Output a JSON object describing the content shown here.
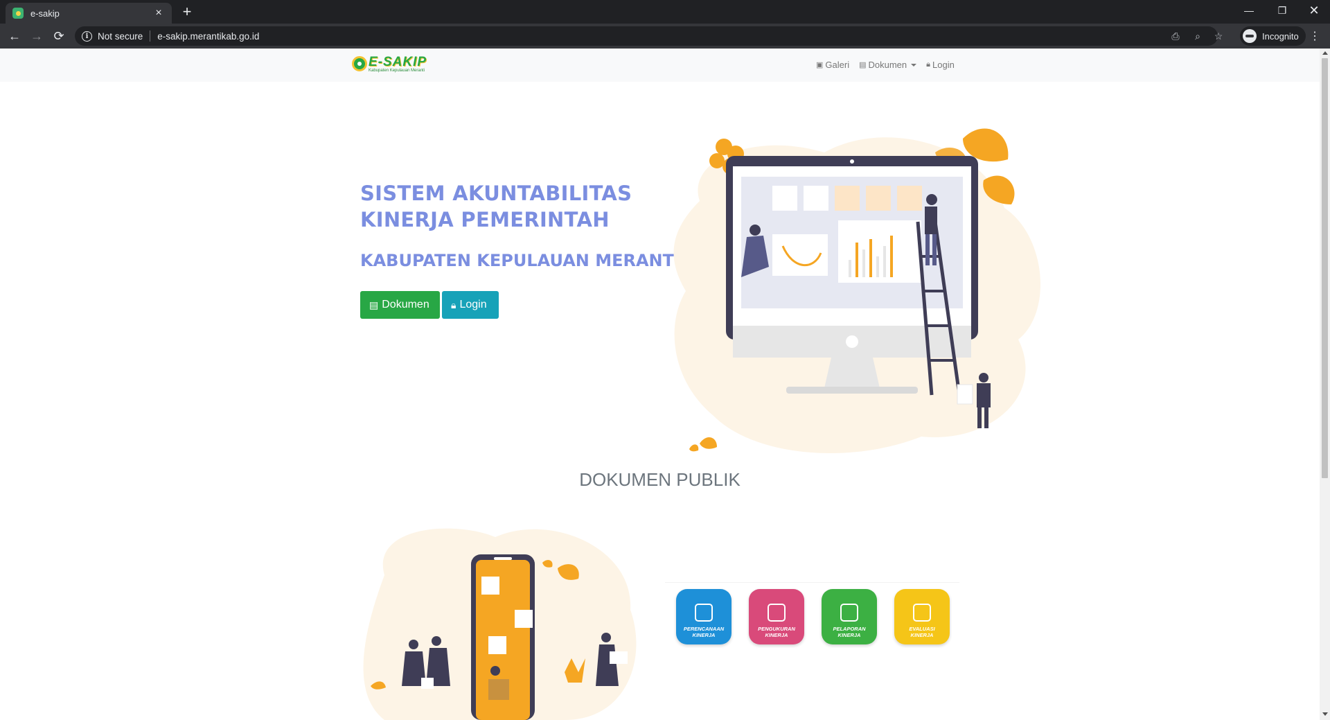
{
  "browser": {
    "tab_title": "e-sakip",
    "new_tab": "+",
    "security_label": "Not secure",
    "url": "e-sakip.merantikab.go.id",
    "profile_label": "Incognito"
  },
  "navbar": {
    "brand_title": "E-SAKIP",
    "brand_subtitle": "Kabupaten Kepulauan Meranti",
    "links": [
      {
        "label": "Galeri",
        "icon": "image-icon"
      },
      {
        "label": "Dokumen",
        "icon": "book-icon"
      },
      {
        "label": "Login",
        "icon": "lock-icon"
      }
    ]
  },
  "hero": {
    "title_line1": "SISTEM AKUNTABILITAS",
    "title_line2": "KINERJA PEMERINTAH",
    "subtitle": "KABUPATEN KEPULAUAN MERANTI",
    "buttons": {
      "dokumen": "Dokumen",
      "login": "Login"
    }
  },
  "documents": {
    "section_title": "DOKUMEN PUBLIK",
    "cards": [
      {
        "label_line1": "PERENCANAAN",
        "label_line2": "KINERJA",
        "color": "#1e90d8"
      },
      {
        "label_line1": "PENGUKURAN",
        "label_line2": "KINERJA",
        "color": "#d94a7a"
      },
      {
        "label_line1": "PELAPORAN",
        "label_line2": "KINERJA",
        "color": "#3cb043"
      },
      {
        "label_line1": "EVALUASI",
        "label_line2": "KINERJA",
        "color": "#f5c518"
      }
    ]
  },
  "colors": {
    "accent": "#7b8ee0",
    "btn_green": "#28a745",
    "btn_teal": "#17a2b8",
    "illustration_orange": "#f5a623",
    "illustration_navy": "#3f3d56"
  }
}
